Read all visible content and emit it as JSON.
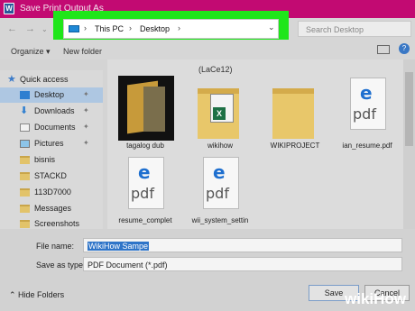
{
  "window": {
    "title": "Save Print Output As",
    "app_icon_letter": "W"
  },
  "address": {
    "crumbs": [
      "This PC",
      "Desktop"
    ]
  },
  "search": {
    "placeholder": "Search Desktop"
  },
  "toolbar": {
    "organize_label": "Organize ▾",
    "new_folder_label": "New folder"
  },
  "sidebar": {
    "items": [
      {
        "label": "Quick access",
        "icon": "star-icon"
      },
      {
        "label": "Desktop",
        "icon": "desktop-icon",
        "selected": true,
        "pinned": true
      },
      {
        "label": "Downloads",
        "icon": "download-icon",
        "pinned": true
      },
      {
        "label": "Documents",
        "icon": "documents-icon",
        "pinned": true
      },
      {
        "label": "Pictures",
        "icon": "pictures-icon",
        "pinned": true
      },
      {
        "label": "bisnis",
        "icon": "folder-icon"
      },
      {
        "label": "STACKD",
        "icon": "folder-icon"
      },
      {
        "label": "113D7000",
        "icon": "folder-icon"
      },
      {
        "label": "Messages",
        "icon": "folder-icon"
      },
      {
        "label": "Screenshots",
        "icon": "folder-icon"
      }
    ]
  },
  "main": {
    "group_label": "(LaCe12)",
    "files": [
      {
        "name": "tagalog dub",
        "kind": "image"
      },
      {
        "name": "wikihow",
        "kind": "excel-folder"
      },
      {
        "name": "WIKIPROJECT",
        "kind": "folder"
      },
      {
        "name": "ian_resume.pdf",
        "kind": "pdf"
      },
      {
        "name": "resume_complet",
        "kind": "pdf"
      },
      {
        "name": "wii_system_settin",
        "kind": "pdf"
      }
    ]
  },
  "form": {
    "file_name_label": "File name:",
    "file_name_value": "WikiHow Sampe",
    "save_type_label": "Save as type:",
    "save_type_value": "PDF Document (*.pdf)"
  },
  "footer": {
    "hide_folders_label": "Hide Folders",
    "save_label": "Save",
    "cancel_label": "Cancel"
  },
  "watermark": {
    "prefix": "wiki",
    "suffix": "How"
  },
  "colors": {
    "title_bar": "#c20a72",
    "highlight": "#1fe61a",
    "selection": "#2e74c8"
  }
}
